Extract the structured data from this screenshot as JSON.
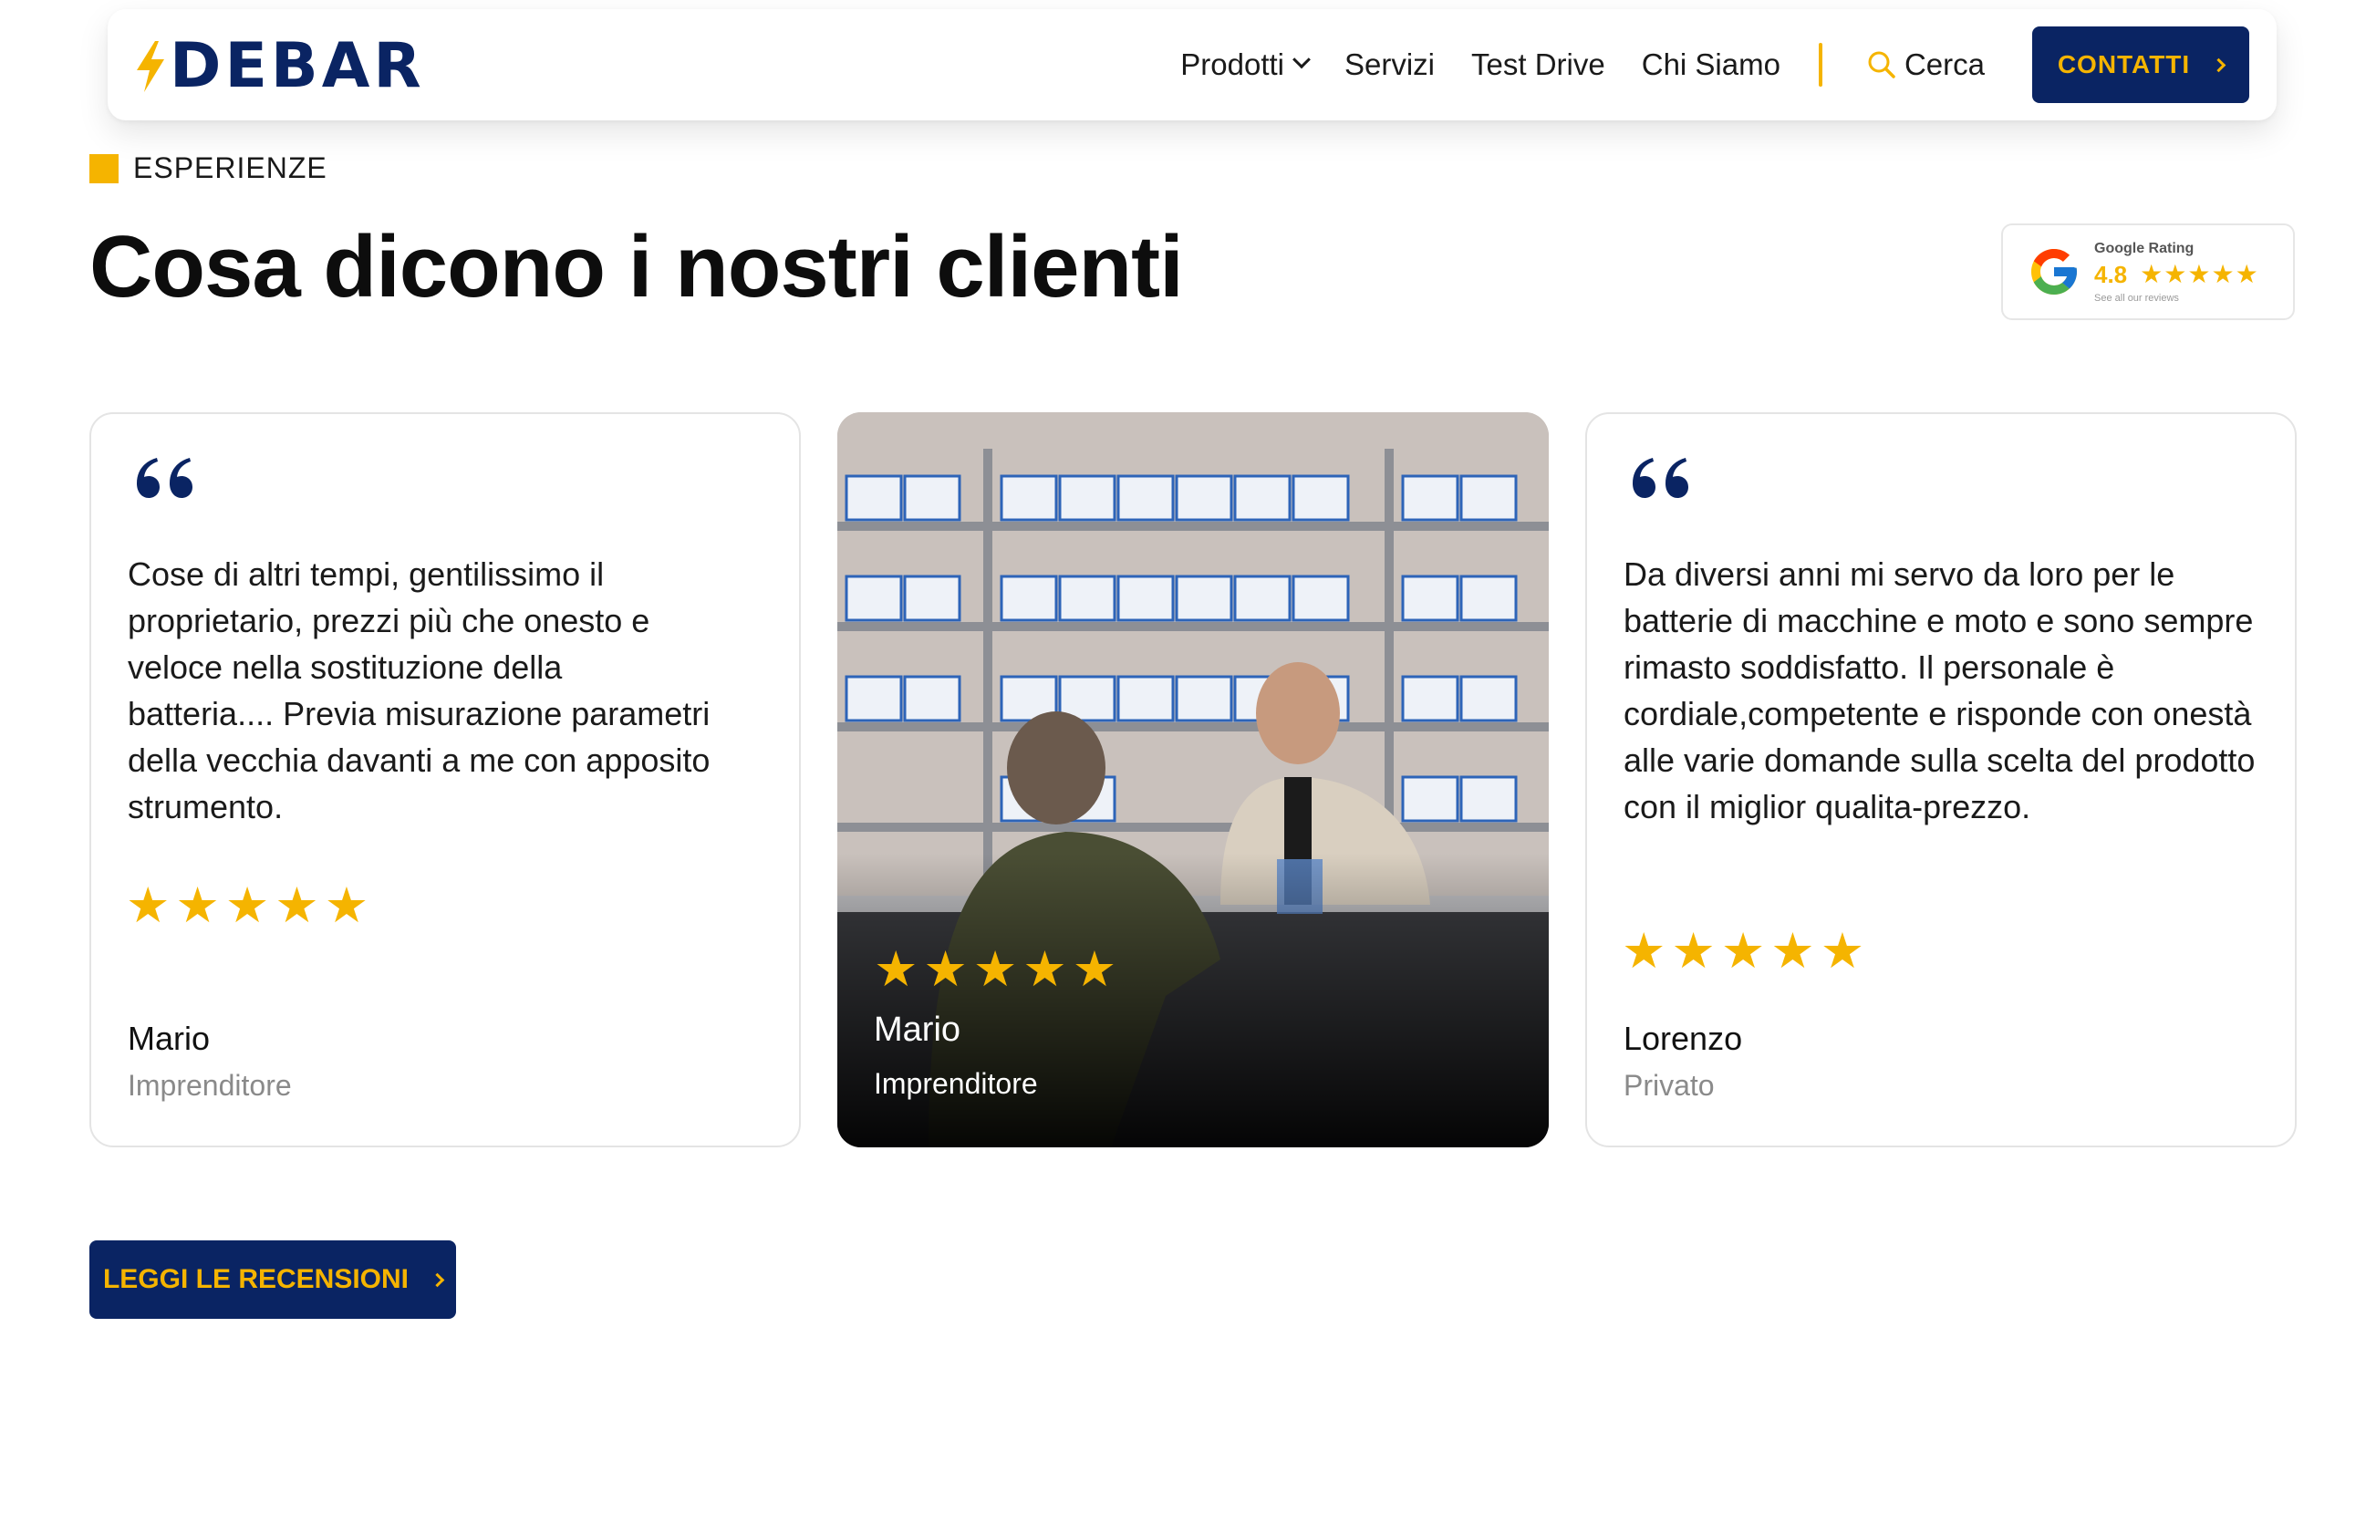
{
  "brand": {
    "name": "DEBAR",
    "accent": "#f5b400",
    "primary": "#0a2463"
  },
  "nav": {
    "items": [
      {
        "label": "Prodotti",
        "has_dropdown": true
      },
      {
        "label": "Servizi"
      },
      {
        "label": "Test Drive"
      },
      {
        "label": "Chi Siamo"
      }
    ],
    "search_label": "Cerca",
    "contact_label": "CONTATTI"
  },
  "section": {
    "eyebrow": "ESPERIENZE",
    "title": "Cosa dicono i nostri clienti"
  },
  "google_rating": {
    "label": "Google Rating",
    "value": "4.8",
    "stars": 5,
    "sub": "See all our reviews"
  },
  "testimonials": [
    {
      "text": "Cose di altri tempi, gentilissimo il proprietario, prezzi più che onesto e veloce nella sostituzione della batteria.... Previa misurazione parametri della vecchia davanti a me con apposito strumento.",
      "stars": 5,
      "name": "Mario",
      "role": "Imprenditore"
    },
    {
      "image": "shop-counter-photo",
      "stars": 5,
      "name": "Mario",
      "role": "Imprenditore"
    },
    {
      "text": "Da diversi anni mi servo da loro per le batterie di macchine e moto e sono sempre rimasto soddisfatto. Il personale è cordiale,competente e risponde con onestà alle varie domande sulla scelta del prodotto con il miglior qualita-prezzo.",
      "stars": 5,
      "name": "Lorenzo",
      "role": "Privato"
    }
  ],
  "cta": {
    "label": "LEGGI LE RECENSIONI"
  }
}
